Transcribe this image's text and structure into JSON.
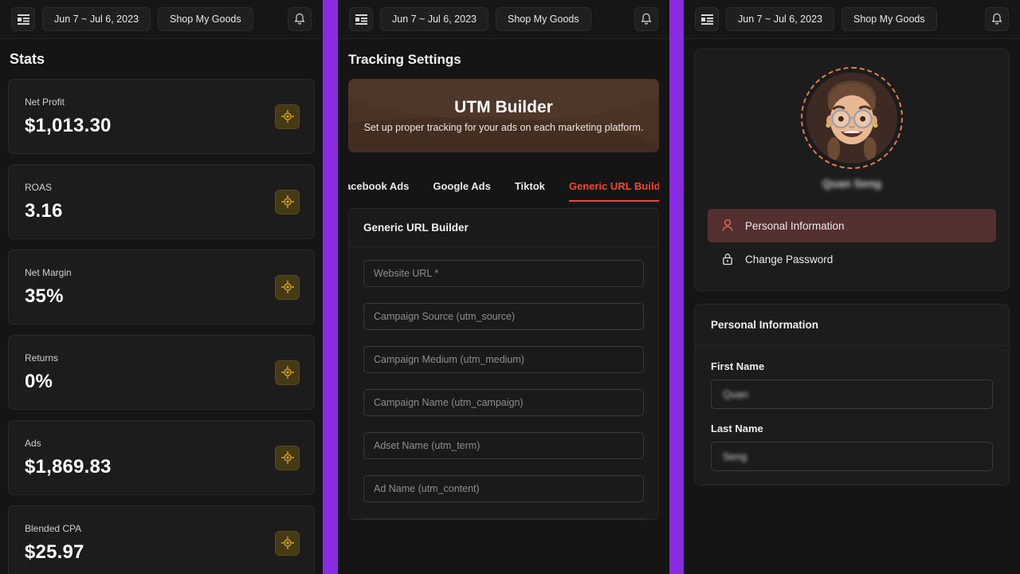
{
  "topbar": {
    "menu_icon": "sidebar-toggle-icon",
    "date_range": "Jun 7 ~ Jul 6, 2023",
    "store_name": "Shop My Goods",
    "bell_icon": "bell-icon"
  },
  "panel1": {
    "title": "Stats",
    "badge_icon": "target-crosshair-icon",
    "stats": [
      {
        "label": "Net Profit",
        "value": "$1,013.30"
      },
      {
        "label": "ROAS",
        "value": "3.16"
      },
      {
        "label": "Net Margin",
        "value": "35%"
      },
      {
        "label": "Returns",
        "value": "0%"
      },
      {
        "label": "Ads",
        "value": "$1,869.83"
      },
      {
        "label": "Blended CPA",
        "value": "$25.97"
      }
    ]
  },
  "panel2": {
    "title": "Tracking Settings",
    "banner": {
      "title": "UTM Builder",
      "subtitle": "Set up proper tracking for your ads on each marketing platform."
    },
    "tabs": [
      {
        "label": "Facebook Ads",
        "active": false
      },
      {
        "label": "Google Ads",
        "active": false
      },
      {
        "label": "Tiktok",
        "active": false
      },
      {
        "label": "Generic URL Builder",
        "active": true
      }
    ],
    "form": {
      "heading": "Generic URL Builder",
      "fields": [
        {
          "placeholder": "Website URL *"
        },
        {
          "placeholder": "Campaign Source (utm_source)"
        },
        {
          "placeholder": "Campaign Medium (utm_medium)"
        },
        {
          "placeholder": "Campaign Name (utm_campaign)"
        },
        {
          "placeholder": "Adset Name (utm_term)"
        },
        {
          "placeholder": "Ad Name (utm_content)"
        }
      ]
    },
    "accent_color": "#f0482f"
  },
  "panel3": {
    "avatar_icon": "user-avatar-memoji",
    "user_name": "Quan Seng",
    "nav": [
      {
        "label": "Personal Information",
        "icon": "person-icon",
        "active": true
      },
      {
        "label": "Change Password",
        "icon": "lock-icon",
        "active": false
      }
    ],
    "info_card": {
      "heading": "Personal Information",
      "fields": [
        {
          "label": "First Name",
          "value": "Quan"
        },
        {
          "label": "Last Name",
          "value": "Seng"
        }
      ]
    }
  },
  "colors": {
    "divider_purple": "#8a2be2",
    "accent_red": "#f0482f",
    "badge_gold": "#d9a520",
    "banner_brown": "#4a3225"
  }
}
